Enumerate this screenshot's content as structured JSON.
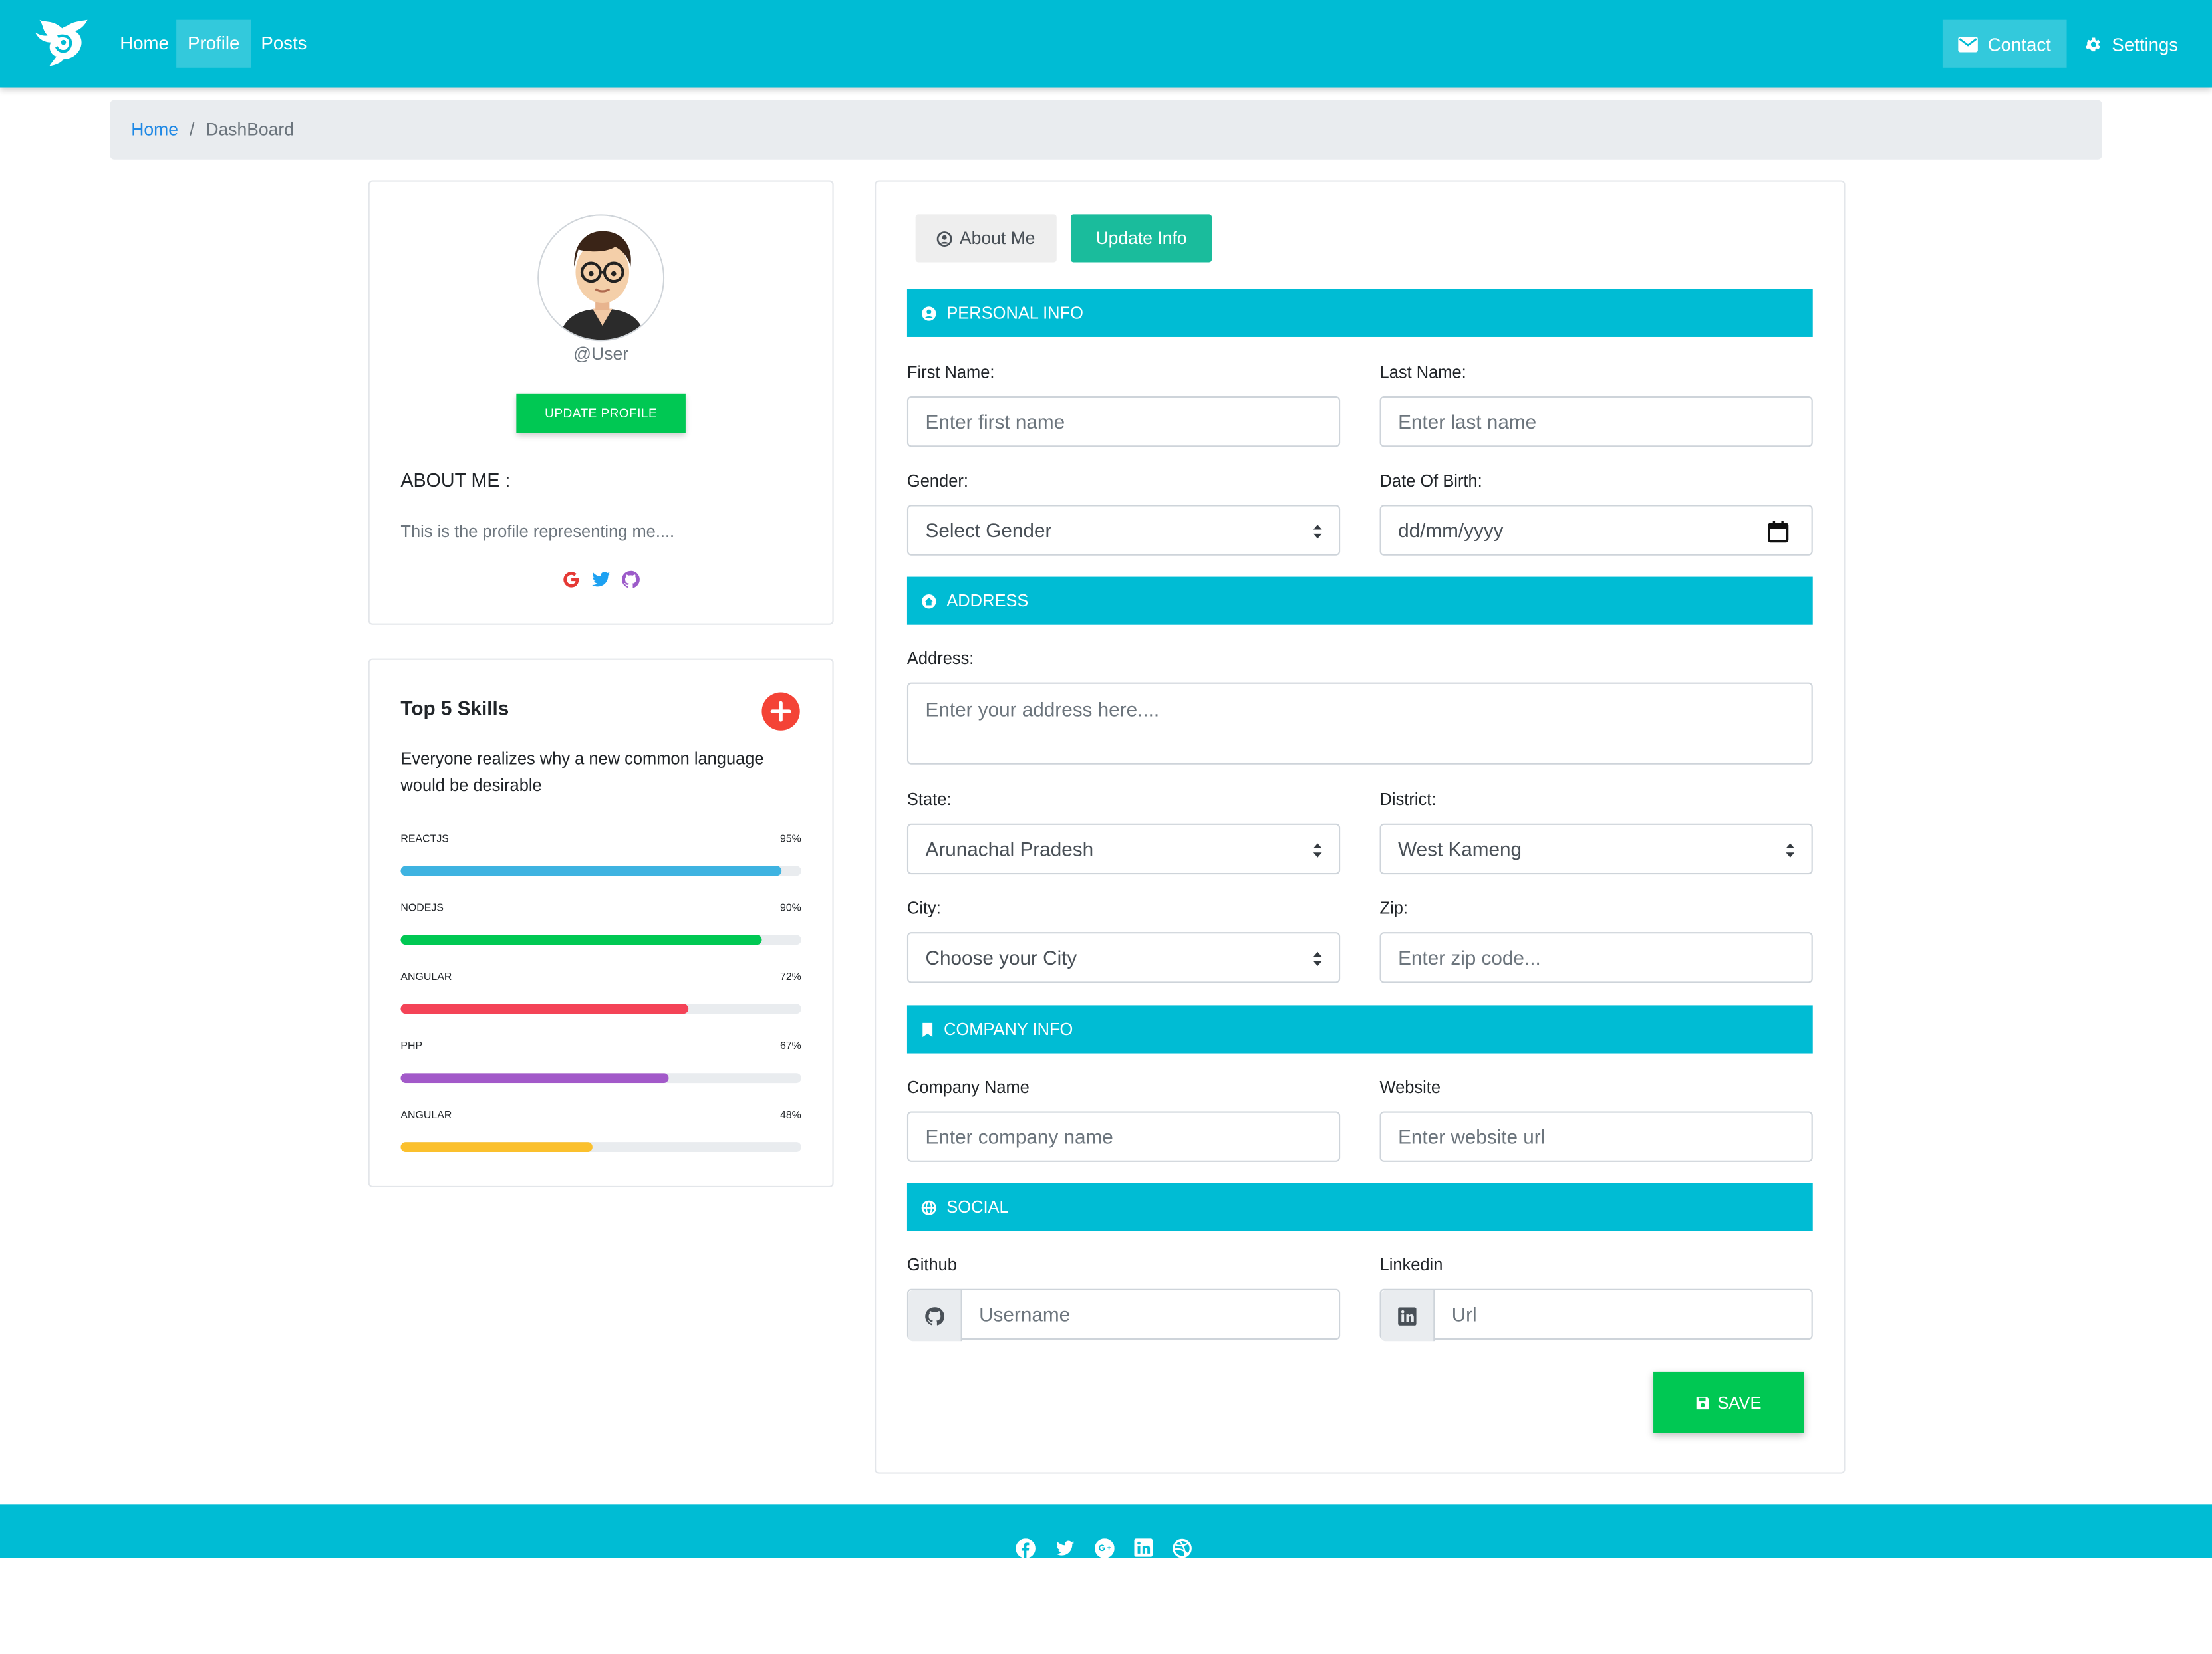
{
  "navbar": {
    "links": [
      {
        "label": "Home"
      },
      {
        "label": "Profile"
      },
      {
        "label": "Posts"
      }
    ],
    "contact_label": "Contact",
    "settings_label": "Settings"
  },
  "breadcrumb": {
    "home": "Home",
    "separator": "/",
    "current": "DashBoard"
  },
  "profile": {
    "username": "@User",
    "update_button": "UPDATE PROFILE",
    "about_heading": "ABOUT ME :",
    "about_text": "This is the profile representing me....",
    "social_icons": [
      "google-icon",
      "twitter-icon",
      "github-icon"
    ]
  },
  "skills": {
    "title": "Top 5 Skills",
    "description": "Everyone realizes why a new common language would be desirable",
    "items": [
      {
        "name": "REACTJS",
        "percent_label": "95%",
        "value": 95,
        "color": "#3eb3e1"
      },
      {
        "name": "NODEJS",
        "percent_label": "90%",
        "value": 90,
        "color": "#00c853"
      },
      {
        "name": "ANGULAR",
        "percent_label": "72%",
        "value": 72,
        "color": "#f44357"
      },
      {
        "name": "PHP",
        "percent_label": "67%",
        "value": 67,
        "color": "#a259c9"
      },
      {
        "name": "ANGULAR",
        "percent_label": "48%",
        "value": 48,
        "color": "#fbc02d"
      }
    ]
  },
  "tabs": {
    "about": "About Me",
    "update": "Update Info"
  },
  "form": {
    "personal": {
      "section": "PERSONAL INFO",
      "first_name_label": "First Name:",
      "first_name_placeholder": "Enter first name",
      "last_name_label": "Last Name:",
      "last_name_placeholder": "Enter last name",
      "gender_label": "Gender:",
      "gender_value": "Select Gender",
      "dob_label": "Date Of Birth:",
      "dob_value": "dd/mm/yyyy"
    },
    "address": {
      "section": "ADDRESS",
      "address_label": "Address:",
      "address_placeholder": "Enter your address here....",
      "state_label": "State:",
      "state_value": "Arunachal Pradesh",
      "district_label": "District:",
      "district_value": "West Kameng",
      "city_label": "City:",
      "city_value": "Choose your City",
      "zip_label": "Zip:",
      "zip_placeholder": "Enter zip code..."
    },
    "company": {
      "section": "COMPANY INFO",
      "name_label": "Company Name",
      "name_placeholder": "Enter company name",
      "website_label": "Website",
      "website_placeholder": "Enter website url"
    },
    "social": {
      "section": "SOCIAL",
      "github_label": "Github",
      "github_placeholder": "Username",
      "linkedin_label": "Linkedin",
      "linkedin_placeholder": "Url"
    },
    "save_label": "SAVE"
  },
  "colors": {
    "primary": "#00bcd4",
    "success": "#00c853",
    "teal": "#1abc9c",
    "danger": "#f44336"
  },
  "footer": {
    "social_icons": [
      "facebook-icon",
      "twitter-icon",
      "google-plus-icon",
      "linkedin-icon",
      "dribbble-icon"
    ]
  }
}
